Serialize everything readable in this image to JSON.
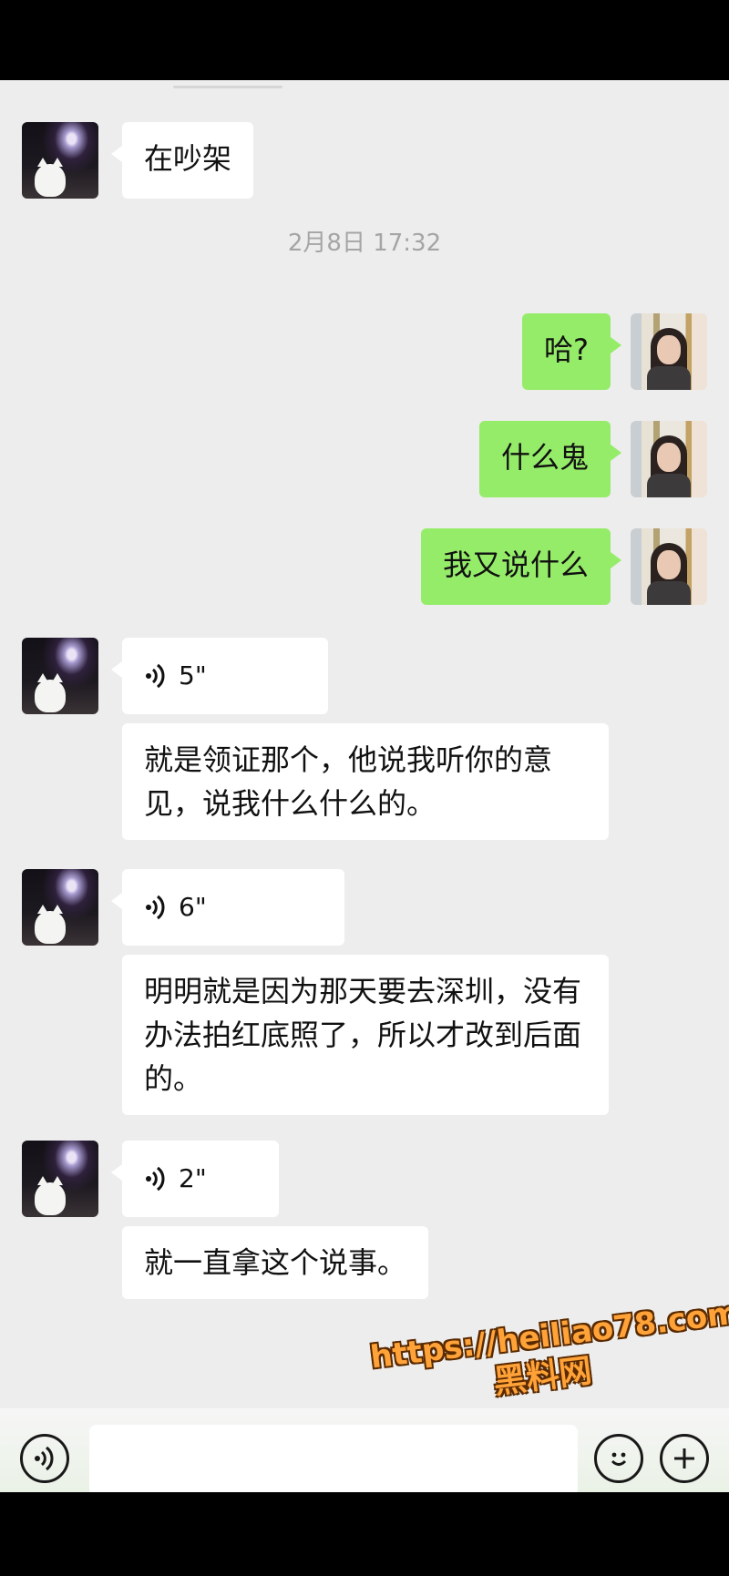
{
  "chat": {
    "timestamp": "2月8日 17:32",
    "messages": [
      {
        "sender": "other",
        "type": "text",
        "text": "在吵架"
      },
      {
        "sender": "me",
        "type": "text",
        "text": "哈?"
      },
      {
        "sender": "me",
        "type": "text",
        "text": "什么鬼"
      },
      {
        "sender": "me",
        "type": "text",
        "text": "我又说什么"
      },
      {
        "sender": "other",
        "type": "voice",
        "duration": "5\""
      },
      {
        "sender": "other",
        "type": "text",
        "text": "就是领证那个，他说我听你的意见，说我什么什么的。"
      },
      {
        "sender": "other",
        "type": "voice",
        "duration": "6\""
      },
      {
        "sender": "other",
        "type": "text",
        "text": "明明就是因为那天要去深圳，没有办法拍红底照了，所以才改到后面的。"
      },
      {
        "sender": "other",
        "type": "voice",
        "duration": "2\""
      },
      {
        "sender": "other",
        "type": "text",
        "text": "就一直拿这个说事。"
      }
    ]
  },
  "watermark": {
    "url": "https://heiliao78.com",
    "name": "黑料网",
    "color": "#ffa238"
  },
  "icons": {
    "voice_toggle": "voice-icon",
    "emoji": "emoji-icon",
    "more": "plus-icon"
  },
  "colors": {
    "outgoing_bubble": "#95ec69",
    "incoming_bubble": "#ffffff",
    "background": "#ededed"
  }
}
